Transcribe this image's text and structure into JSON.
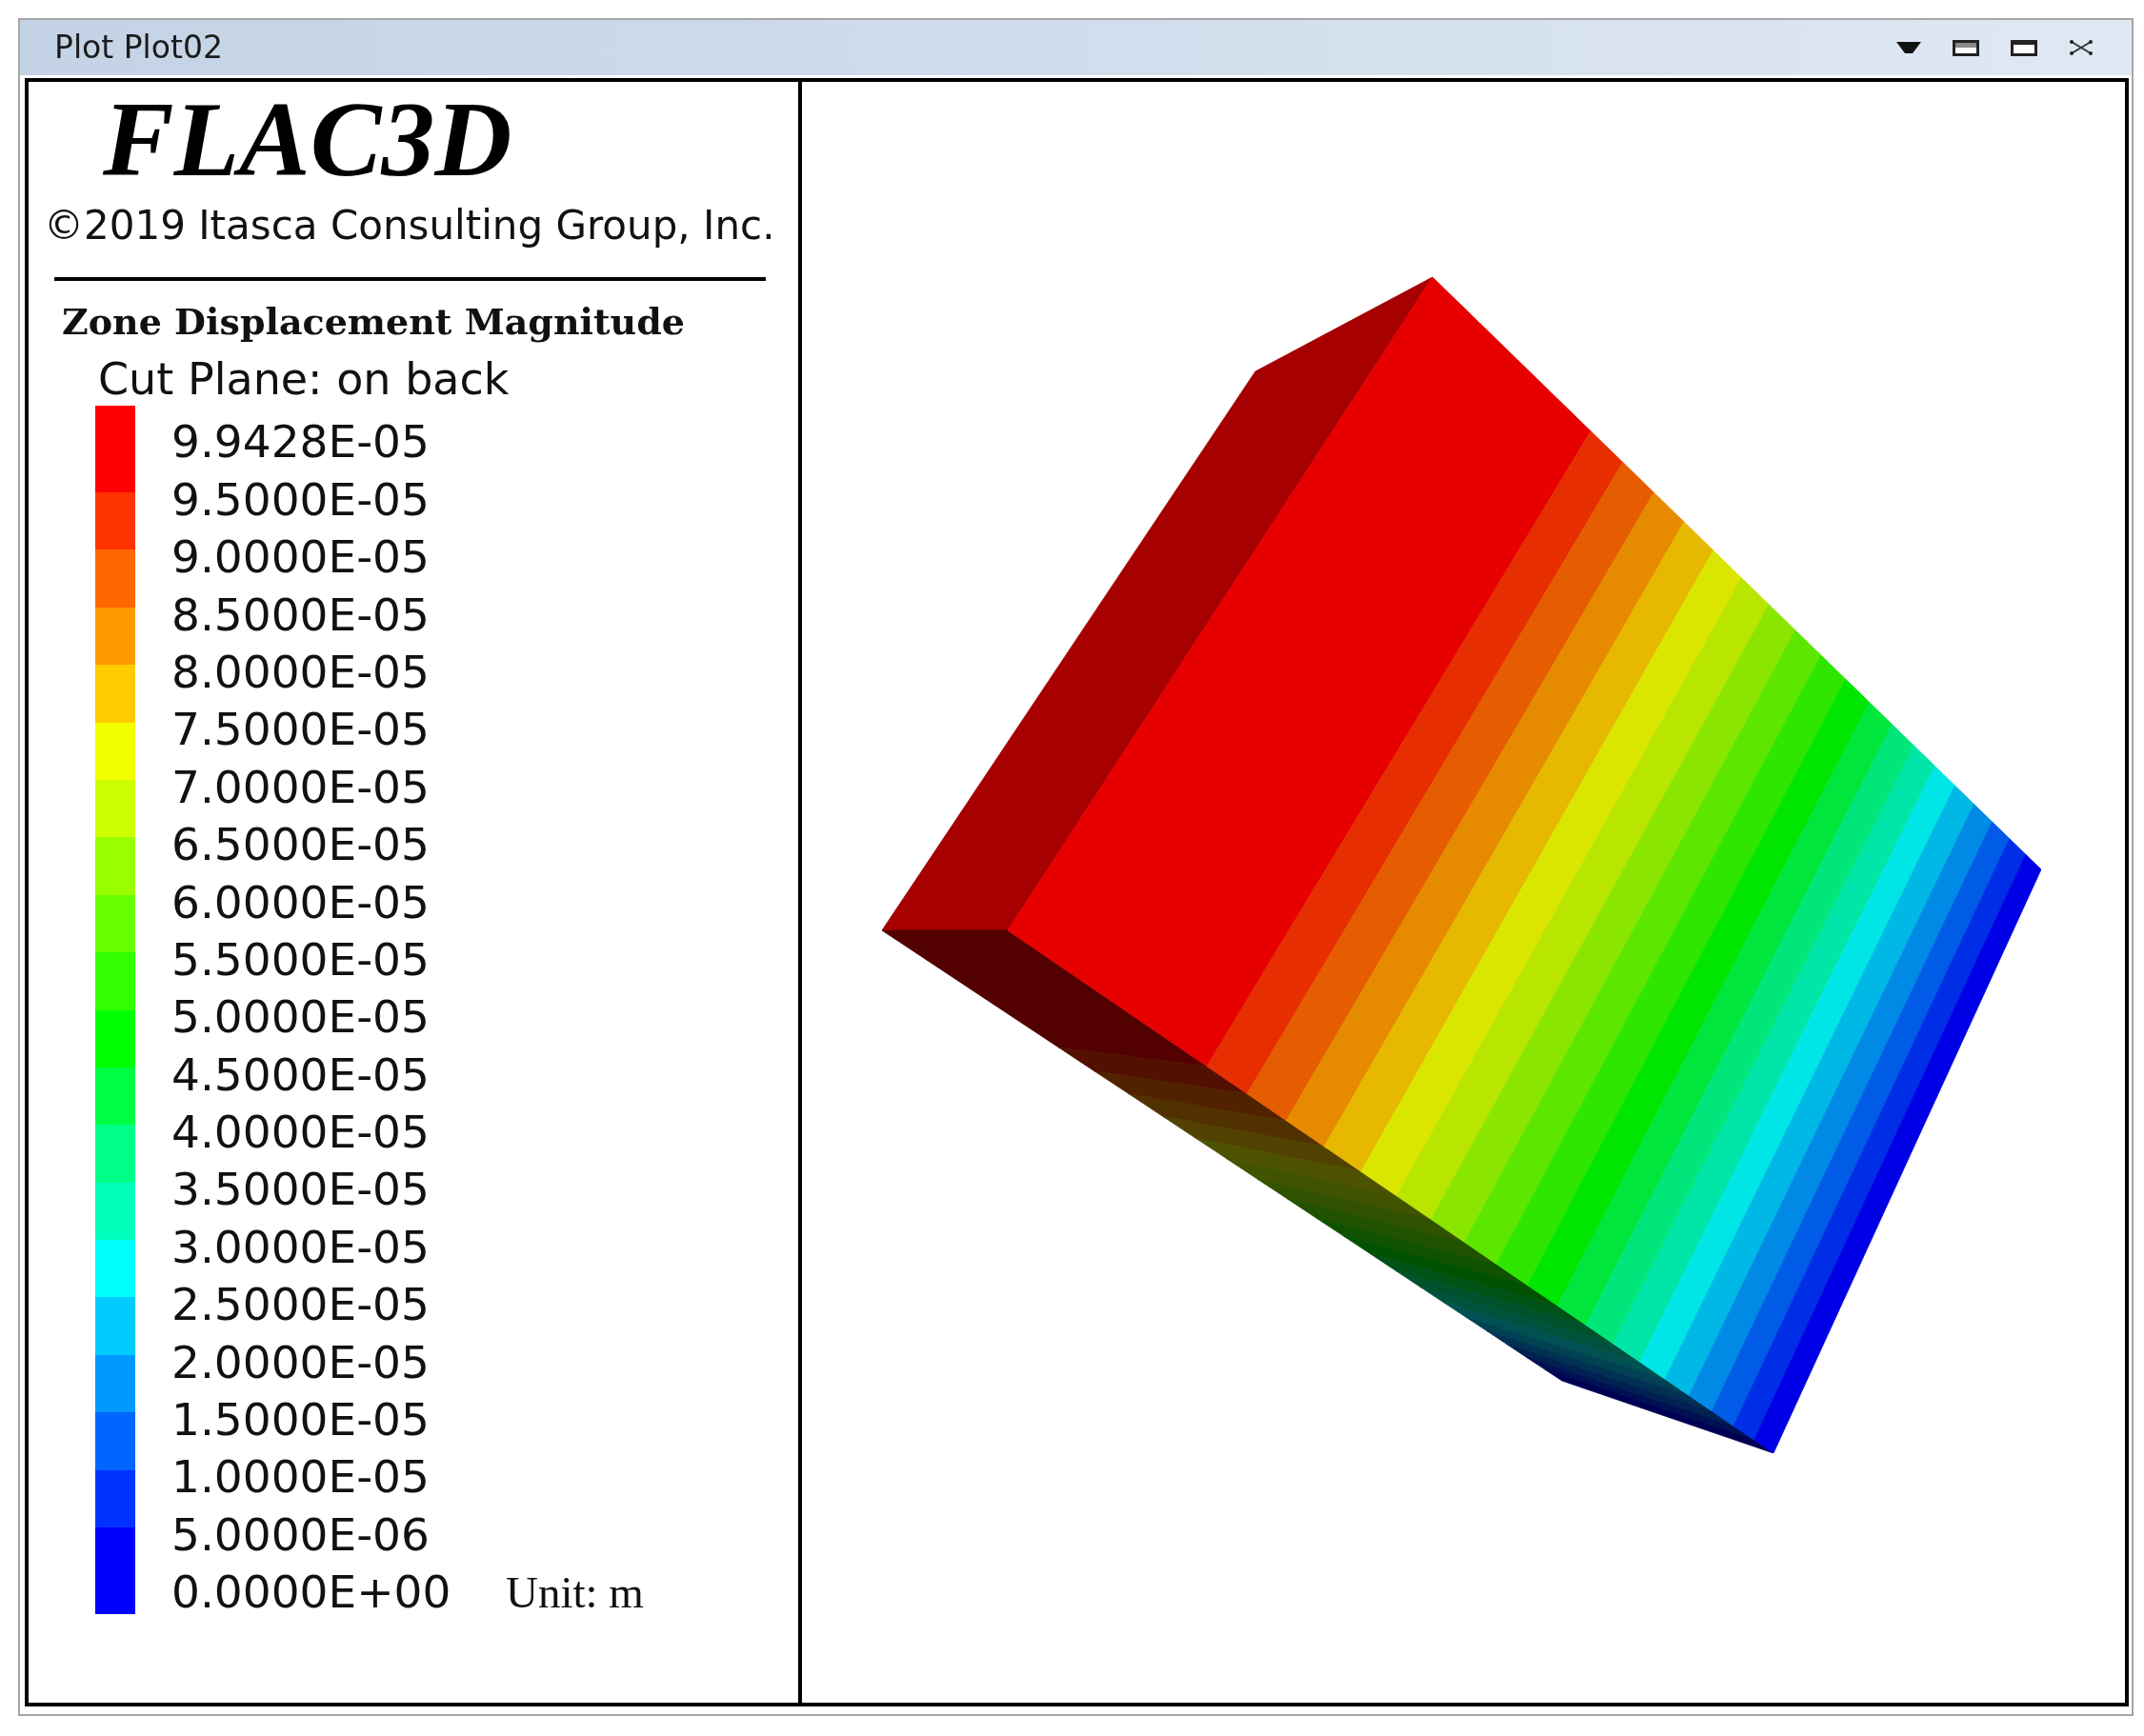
{
  "window": {
    "title": "Plot Plot02"
  },
  "legend": {
    "logo": "FLAC3D",
    "copyright": "©2019 Itasca Consulting Group, Inc.",
    "title": "Zone Displacement Magnitude",
    "subtitle": "Cut Plane: on back",
    "labels": [
      "9.9428E-05",
      "9.5000E-05",
      "9.0000E-05",
      "8.5000E-05",
      "8.0000E-05",
      "7.5000E-05",
      "7.0000E-05",
      "6.5000E-05",
      "6.0000E-05",
      "5.5000E-05",
      "5.0000E-05",
      "4.5000E-05",
      "4.0000E-05",
      "3.5000E-05",
      "3.0000E-05",
      "2.5000E-05",
      "2.0000E-05",
      "1.5000E-05",
      "1.0000E-05",
      "5.0000E-06",
      "0.0000E+00"
    ],
    "bands": [
      {
        "color": "#ff0000"
      },
      {
        "color": "#ff3300"
      },
      {
        "color": "#ff6600"
      },
      {
        "color": "#ff9900"
      },
      {
        "color": "#ffcc00"
      },
      {
        "color": "#f2ff00"
      },
      {
        "color": "#ccff00"
      },
      {
        "color": "#99ff00"
      },
      {
        "color": "#66ff00"
      },
      {
        "color": "#33ff00"
      },
      {
        "color": "#00ff00"
      },
      {
        "color": "#00ff44"
      },
      {
        "color": "#00ff88"
      },
      {
        "color": "#00ffbb"
      },
      {
        "color": "#00ffff"
      },
      {
        "color": "#00ccff"
      },
      {
        "color": "#0099ff"
      },
      {
        "color": "#0066ff"
      },
      {
        "color": "#0033ff"
      },
      {
        "color": "#0000ff"
      }
    ],
    "unit": "Unit: m"
  }
}
